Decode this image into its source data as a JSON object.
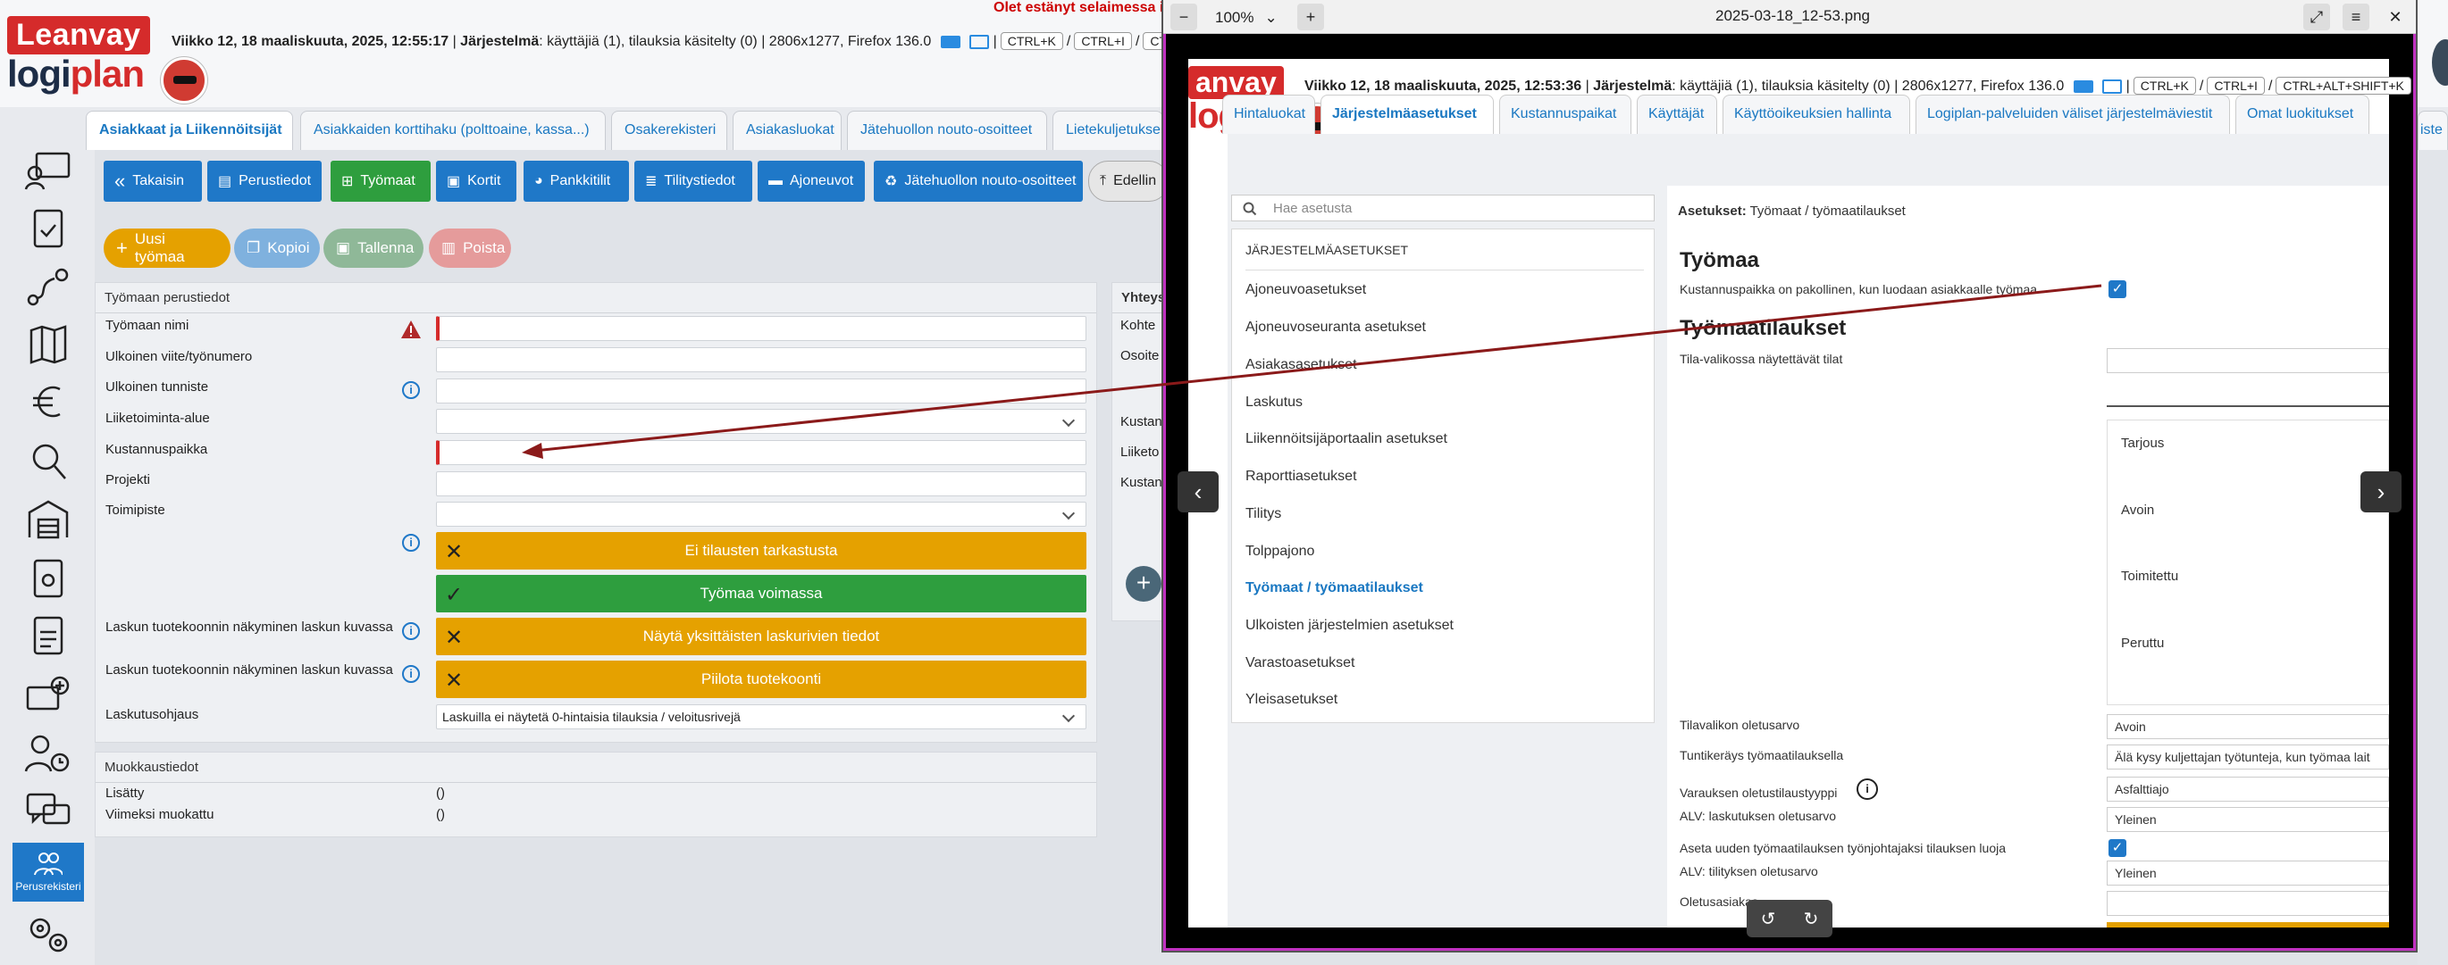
{
  "header": {
    "logo_top": "Leanvay",
    "logo_bottom_a": "logi",
    "logo_bottom_b": "plan",
    "date": "Viikko 12, 18 maaliskuuta, 2025, 12:55:17",
    "system_label": "Järjestelmä",
    "system_text": ": käyttäjiä (1), tilauksia käsitelty (0) | 2806x1277, Firefox 136.0",
    "kbd1": "CTRL+K",
    "kbd2": "CTRL+I",
    "kbd3": "CTRL+ALT+",
    "red_msg": "Olet estänyt selaimessa il"
  },
  "tabs": [
    "Asiakkaat ja Liikennöitsijät",
    "Asiakkaiden korttihaku (polttoaine, kassa...)",
    "Osakerekisteri",
    "Asiakasluokat",
    "Jätehuollon nouto-osoitteet",
    "Lietekuljetukse",
    "iste"
  ],
  "toolbar": [
    "Takaisin",
    "Perustiedot",
    "Työmaat",
    "Kortit",
    "Pankkitilit",
    "Tilitystiedot",
    "Ajoneuvot",
    "Jätehuollon nouto-osoitteet",
    "Edellin"
  ],
  "actions": [
    "Uusi työmaa",
    "Kopioi",
    "Tallenna",
    "Poista"
  ],
  "rail": {
    "peruskey": "Perusrekisteri"
  },
  "basic": {
    "title": "Työmaan perustiedot",
    "fields": [
      "Työmaan nimi",
      "Ulkoinen viite/työnumero",
      "Ulkoinen tunniste",
      "Liiketoiminta-alue",
      "Kustannuspaikka",
      "Projekti",
      "Toimipiste"
    ],
    "status1": "Ei tilausten tarkastusta",
    "status2": "Työmaa voimassa",
    "label_invoice1": "Laskun tuotekoonnin näkyminen laskun kuvassa",
    "status3": "Näytä yksittäisten laskurivien tiedot",
    "label_invoice2": "Laskun tuotekoonnin näkyminen laskun kuvassa",
    "status4": "Piilota tuotekoonti",
    "billing_label": "Laskutusohjaus",
    "billing_value": "Laskuilla ei näytetä 0-hintaisia tilauksia / veloitusrivejä"
  },
  "modify": {
    "title": "Muokkaustiedot",
    "added_label": "Lisätty",
    "added_value": "()",
    "modified_label": "Viimeksi muokattu",
    "modified_value": "()"
  },
  "contact": {
    "title": "Yhteys",
    "labels": [
      "Kohte",
      "Osoite",
      "Kustan",
      "Liiketo",
      "Kustan"
    ]
  },
  "viewer": {
    "zoom": "100%",
    "filename": "2025-03-18_12-53.png"
  },
  "inner": {
    "logo_top": "anvay",
    "logo_bottom": "logiplan",
    "date": "Viikko 12, 18 maaliskuuta, 2025, 12:53:36",
    "system_label": "Järjestelmä",
    "system_text": ": käyttäjiä (1), tilauksia käsitelty (0) | 2806x1277, Firefox 136.0",
    "kbd1": "CTRL+K",
    "kbd2": "CTRL+I",
    "kbd3": "CTRL+ALT+SHIFT+K",
    "tabs": [
      "Hintaluokat",
      "Järjestelmäasetukset",
      "Kustannuspaikat",
      "Käyttäjät",
      "Käyttöoikeuksien hallinta",
      "Logiplan-palveluiden väliset järjestelmäviestit",
      "Omat luokitukset"
    ],
    "search_placeholder": "Hae asetusta",
    "settings_header": "JÄRJESTELMÄASETUKSET",
    "settings": [
      "Ajoneuvoasetukset",
      "Ajoneuvoseuranta asetukset",
      "Asiakasasetukset",
      "Laskutus",
      "Liikennöitsijäportaalin asetukset",
      "Raporttiasetukset",
      "Tilitys",
      "Tolppajono",
      "Työmaat / työmaatilaukset",
      "Ulkoisten järjestelmien asetukset",
      "Varastoasetukset",
      "Yleisasetukset"
    ],
    "breadcrumb_bold": "Asetukset:",
    "breadcrumb_rest": " Työmaat / työmaatilaukset",
    "h_tyomaa": "Työmaa",
    "cost_required": "Kustannuspaikka on pakollinen, kun luodaan asiakkaalle työmaa",
    "h_orders": "Työmaatilaukset",
    "states_label": "Tila-valikossa näytettävät tilat",
    "states": [
      "Tarjous",
      "Avoin",
      "Toimitettu",
      "Peruttu"
    ],
    "default_state_label": "Tilavalikon oletusarvo",
    "default_state_value": "Avoin",
    "hours_label": "Tuntikeräys työmaatilauksella",
    "hours_value": "Älä kysy kuljettajan työtunteja, kun työmaa lait",
    "reserve_label": "Varauksen oletustilaustyyppi",
    "reserve_value": "Asfalttiajo",
    "alv_inv_label": "ALV: laskutuksen oletusarvo",
    "alv_inv_value": "Yleinen",
    "set_manager_label": "Aseta uuden työmaatilauksen työnjohtajaksi tilauksen luoja",
    "alv_pay_label": "ALV: tilityksen oletusarvo",
    "alv_pay_value": "Yleinen",
    "default_customer_label": "Oletusasiakas"
  },
  "colors": {
    "blue": "#1f78c8",
    "green": "#2e9e3e",
    "yellow": "#e5a100",
    "red": "#d52b2b",
    "arrow": "#8b1a1a"
  }
}
